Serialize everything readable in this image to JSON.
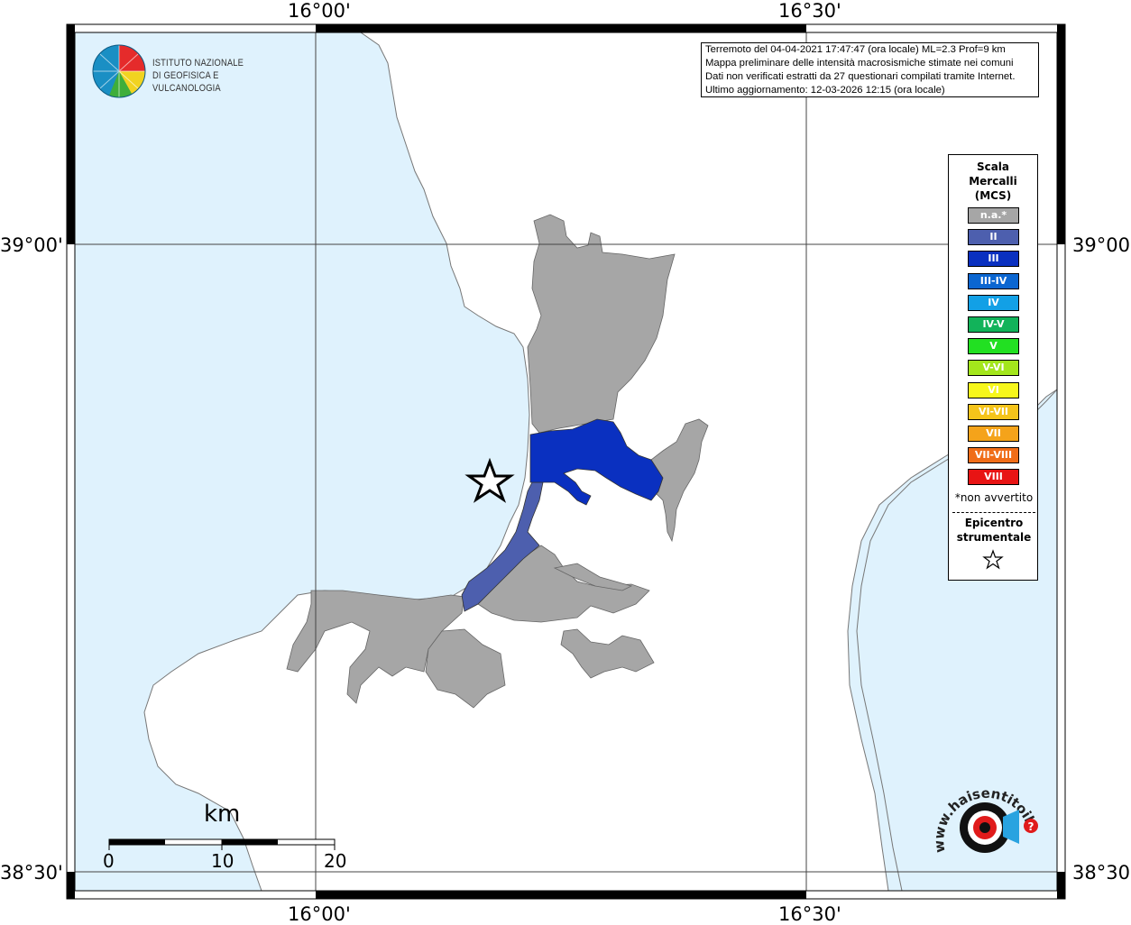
{
  "map": {
    "grid_labels": {
      "top_left_lon": "16°00'",
      "top_right_lon": "16°30'",
      "bottom_left_lon": "16°00'",
      "bottom_right_lon": "16°30'",
      "left_upper_lat": "39°00'",
      "left_lower_lat": "38°30'",
      "right_upper_lat": "39°00'",
      "right_lower_lat": "38°30'"
    },
    "colors": {
      "sea": "#dff2fd",
      "land": "#ffffff",
      "na": "#a6a6a6",
      "II": "#4d5fae",
      "III": "#0a30c0"
    }
  },
  "info": {
    "line1": "Terremoto del 04-04-2021 17:47:47 (ora locale) ML=2.3 Prof=9 km",
    "line2": "Mappa preliminare delle intensità macrosismiche stimate nei comuni",
    "line3": "Dati non verificati estratti da 27 questionari compilati tramite Internet.",
    "line4": "Ultimo aggiornamento: 12-03-2026 12:15 (ora locale)"
  },
  "logo": {
    "line1": "ISTITUTO NAZIONALE",
    "line2": "DI GEOFISICA E VULCANOLOGIA"
  },
  "legend": {
    "title1": "Scala",
    "title2": "Mercalli",
    "title3": "(MCS)",
    "items": [
      {
        "label": "n.a.*",
        "color": "#a6a6a6"
      },
      {
        "label": "II",
        "color": "#4d5fae"
      },
      {
        "label": "III",
        "color": "#0a30c0"
      },
      {
        "label": "III-IV",
        "color": "#0b66d1"
      },
      {
        "label": "IV",
        "color": "#12a0e6"
      },
      {
        "label": "IV-V",
        "color": "#12b35a"
      },
      {
        "label": "V",
        "color": "#22e022"
      },
      {
        "label": "V-VI",
        "color": "#a3e61c"
      },
      {
        "label": "VI",
        "color": "#f7f71b"
      },
      {
        "label": "VI-VII",
        "color": "#f5c41a"
      },
      {
        "label": "VII",
        "color": "#f5a31a"
      },
      {
        "label": "VII-VIII",
        "color": "#f06d18"
      },
      {
        "label": "VIII",
        "color": "#e81414"
      }
    ],
    "note": "*non avvertito",
    "epi1": "Epicentro",
    "epi2": "strumentale"
  },
  "scale": {
    "title": "km",
    "t0": "0",
    "t10": "10",
    "t20": "20"
  },
  "hsi": {
    "text": "www.haisentitoilterremoto.it",
    "mark": "?"
  }
}
